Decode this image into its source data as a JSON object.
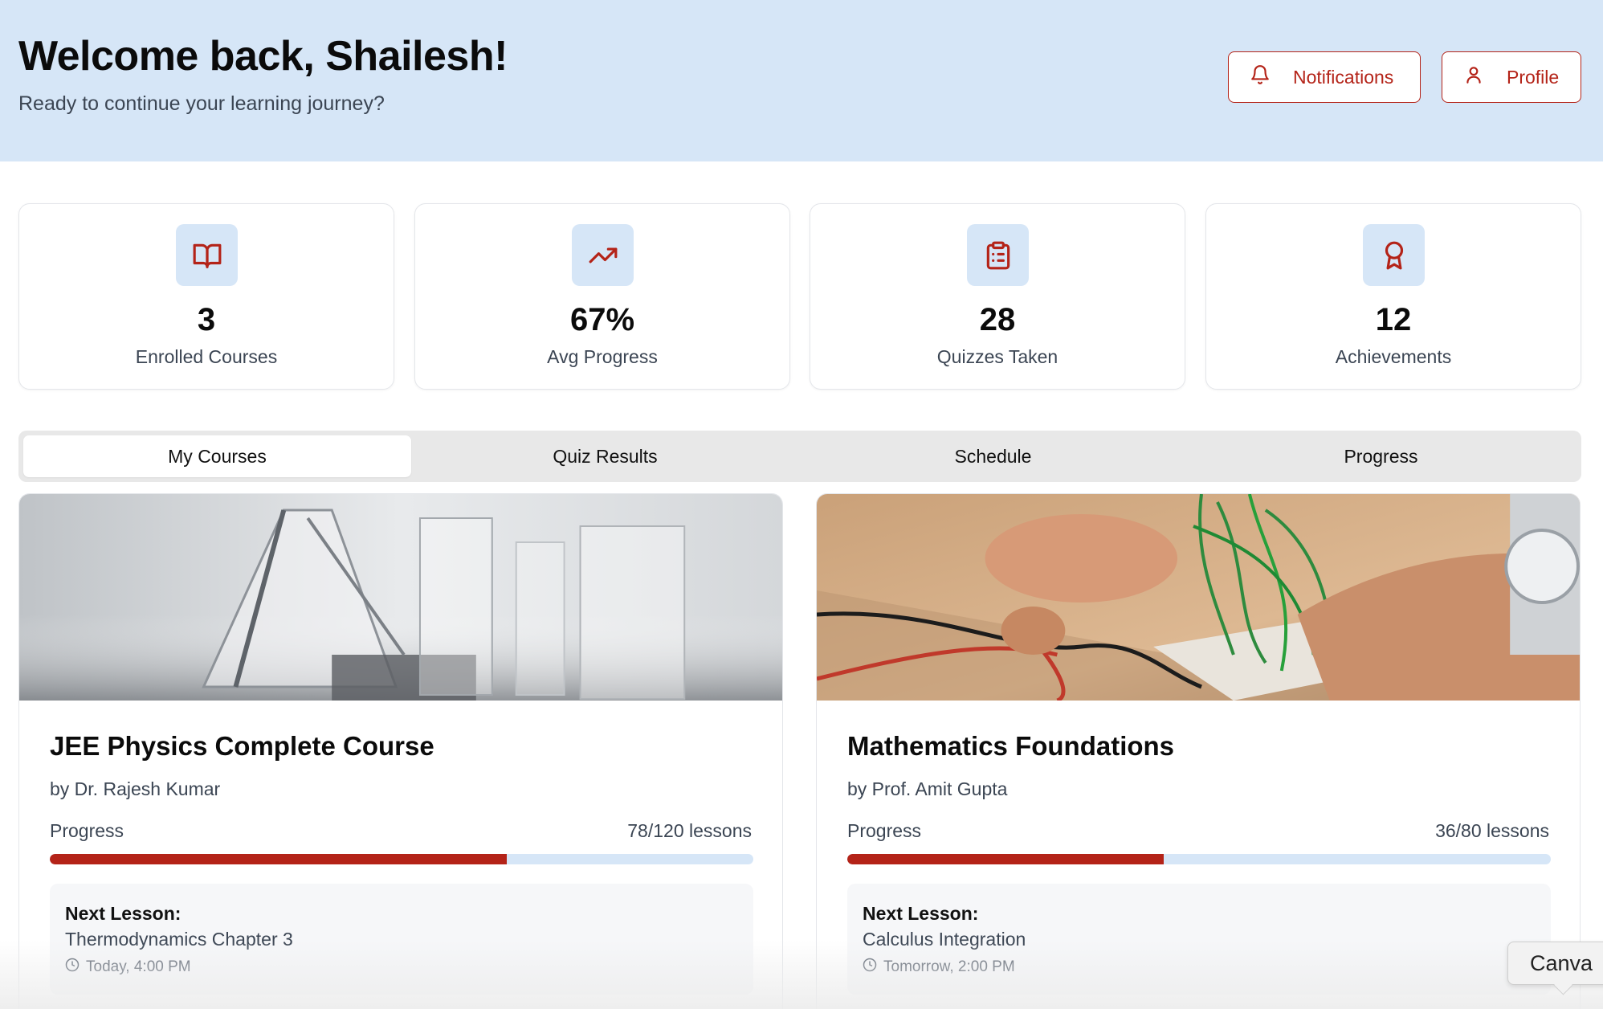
{
  "header": {
    "title": "Welcome back, Shailesh!",
    "subtitle": "Ready to continue your learning journey?",
    "notifications_label": "Notifications",
    "profile_label": "Profile"
  },
  "stats": [
    {
      "icon": "book-open-icon",
      "value": "3",
      "label": "Enrolled Courses"
    },
    {
      "icon": "trending-up-icon",
      "value": "67%",
      "label": "Avg Progress"
    },
    {
      "icon": "clipboard-list-icon",
      "value": "28",
      "label": "Quizzes Taken"
    },
    {
      "icon": "award-icon",
      "value": "12",
      "label": "Achievements"
    }
  ],
  "tabs": [
    {
      "label": "My Courses",
      "active": true
    },
    {
      "label": "Quiz Results",
      "active": false
    },
    {
      "label": "Schedule",
      "active": false
    },
    {
      "label": "Progress",
      "active": false
    }
  ],
  "courses": [
    {
      "title": "JEE Physics Complete Course",
      "instructor": "by Dr. Rajesh Kumar",
      "progress_label": "Progress",
      "lessons": "78/120 lessons",
      "progress_fraction": 0.65,
      "next_label": "Next Lesson:",
      "next_title": "Thermodynamics Chapter 3",
      "next_time": "Today, 4:00 PM"
    },
    {
      "title": "Mathematics Foundations",
      "instructor": "by Prof. Amit Gupta",
      "progress_label": "Progress",
      "lessons": "36/80 lessons",
      "progress_fraction": 0.45,
      "next_label": "Next Lesson:",
      "next_title": "Calculus Integration",
      "next_time": "Tomorrow, 2:00 PM"
    }
  ],
  "tooltip": {
    "label": "Canva"
  },
  "colors": {
    "accent": "#b42318",
    "header_bg": "#d6e6f7",
    "track": "#d6e6f7"
  }
}
